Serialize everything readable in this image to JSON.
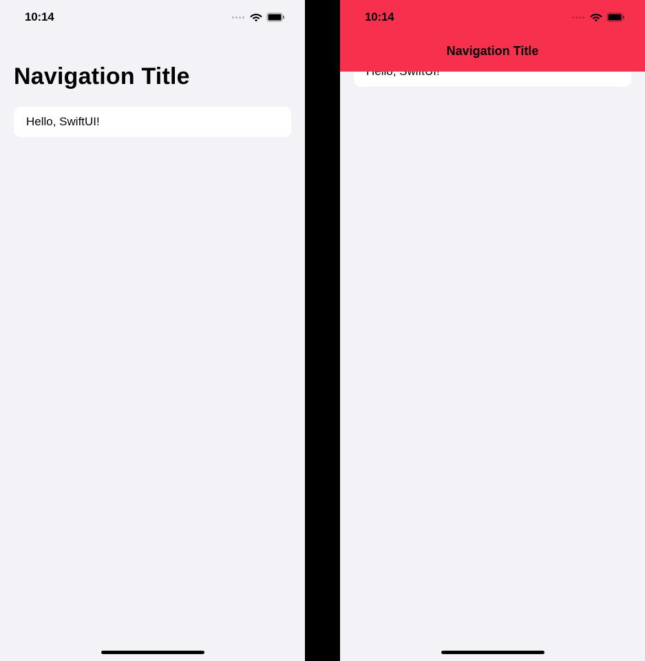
{
  "left": {
    "status": {
      "time": "10:14"
    },
    "nav": {
      "title": "Navigation Title"
    },
    "content": {
      "cell_text": "Hello, SwiftUI!"
    }
  },
  "right": {
    "status": {
      "time": "10:14"
    },
    "nav": {
      "title": "Navigation Title",
      "bg_color": "#f7304e"
    },
    "content": {
      "cell_text": "Hello, SwiftUI!"
    }
  }
}
